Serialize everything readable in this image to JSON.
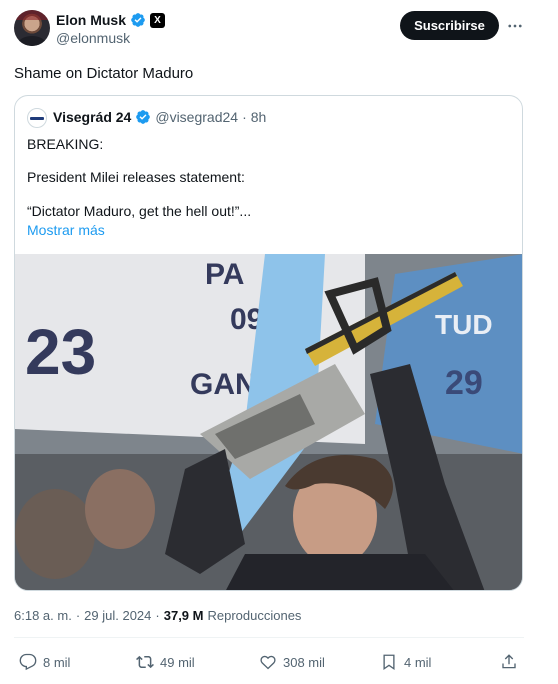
{
  "author": {
    "display_name": "Elon Musk",
    "handle": "@elonmusk",
    "verified": true,
    "affiliate_badge": "X"
  },
  "subscribe_label": "Suscribirse",
  "tweet_text": "Shame on Dictator Maduro",
  "quote": {
    "display_name": "Visegrád 24",
    "handle": "@visegrad24",
    "separator": "·",
    "time": "8h",
    "lines": [
      "BREAKING:",
      "President Milei releases statement:",
      "“Dictator Maduro, get the hell out!”..."
    ],
    "show_more": "Mostrar más"
  },
  "meta": {
    "time": "6:18 a. m.",
    "separator": "·",
    "date": "29 jul. 2024",
    "views_count": "37,9 M",
    "views_label": "Reproducciones"
  },
  "actions": {
    "replies": "8 mil",
    "reposts": "49 mil",
    "likes": "308 mil",
    "bookmarks": "4 mil"
  },
  "colors": {
    "accent": "#1d9bf0",
    "muted": "#536471",
    "text": "#0f1419",
    "border": "#cfd9de"
  },
  "icons": [
    "more-icon",
    "verified-icon",
    "reply-icon",
    "repost-icon",
    "like-icon",
    "bookmark-icon",
    "share-icon"
  ]
}
